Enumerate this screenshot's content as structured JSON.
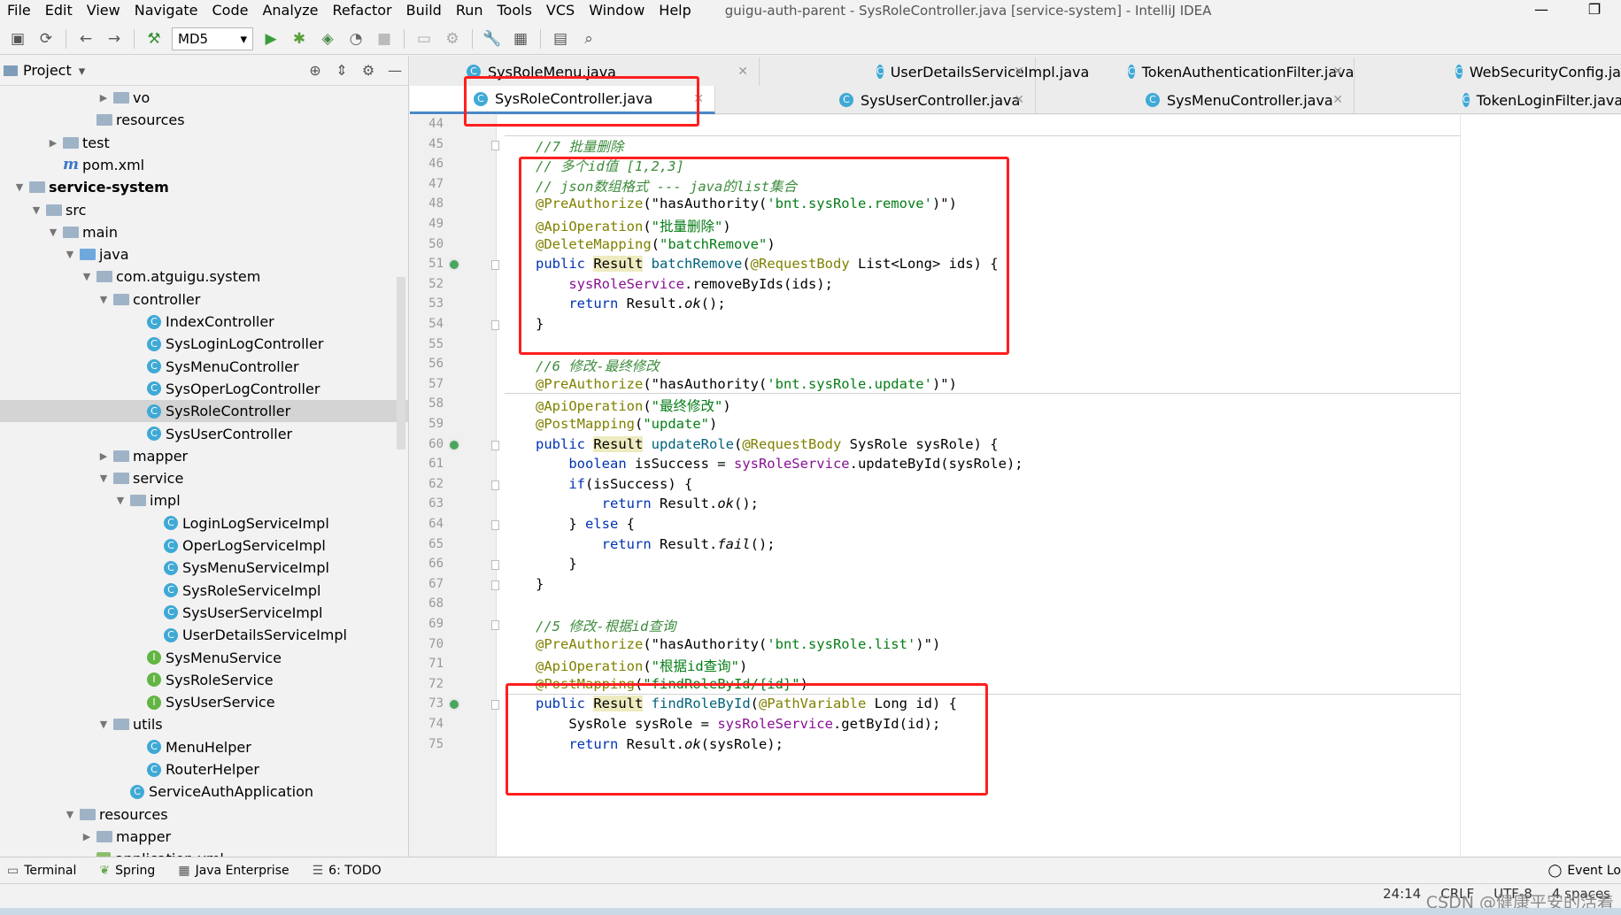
{
  "menu": [
    "File",
    "Edit",
    "View",
    "Navigate",
    "Code",
    "Analyze",
    "Refactor",
    "Build",
    "Run",
    "Tools",
    "VCS",
    "Window",
    "Help"
  ],
  "window_title": "guigu-auth-parent - SysRoleController.java [service-system] - IntelliJ IDEA",
  "toolbar": {
    "run_config": "MD5"
  },
  "project": {
    "title": "Project",
    "tree": [
      {
        "label": "vo",
        "kind": "folder",
        "arrow": "▶"
      },
      {
        "label": "resources",
        "kind": "folder",
        "arrow": ""
      },
      {
        "label": "test",
        "kind": "folder",
        "arrow": "▶"
      },
      {
        "label": "pom.xml",
        "kind": "maven",
        "arrow": ""
      },
      {
        "label": "service-system",
        "kind": "folder",
        "arrow": "▼"
      },
      {
        "label": "src",
        "kind": "folder",
        "arrow": "▼"
      },
      {
        "label": "main",
        "kind": "folder",
        "arrow": "▼"
      },
      {
        "label": "java",
        "kind": "folder-blue",
        "arrow": "▼"
      },
      {
        "label": "com.atguigu.system",
        "kind": "folder",
        "arrow": "▼"
      },
      {
        "label": "controller",
        "kind": "folder",
        "arrow": "▼"
      },
      {
        "label": "IndexController",
        "kind": "class",
        "arrow": ""
      },
      {
        "label": "SysLoginLogController",
        "kind": "class",
        "arrow": ""
      },
      {
        "label": "SysMenuController",
        "kind": "class",
        "arrow": ""
      },
      {
        "label": "SysOperLogController",
        "kind": "class",
        "arrow": ""
      },
      {
        "label": "SysRoleController",
        "kind": "class",
        "arrow": "",
        "selected": true
      },
      {
        "label": "SysUserController",
        "kind": "class",
        "arrow": ""
      },
      {
        "label": "mapper",
        "kind": "folder",
        "arrow": "▶"
      },
      {
        "label": "service",
        "kind": "folder",
        "arrow": "▼"
      },
      {
        "label": "impl",
        "kind": "folder",
        "arrow": "▼"
      },
      {
        "label": "LoginLogServiceImpl",
        "kind": "class",
        "arrow": ""
      },
      {
        "label": "OperLogServiceImpl",
        "kind": "class",
        "arrow": ""
      },
      {
        "label": "SysMenuServiceImpl",
        "kind": "class",
        "arrow": ""
      },
      {
        "label": "SysRoleServiceImpl",
        "kind": "class",
        "arrow": ""
      },
      {
        "label": "SysUserServiceImpl",
        "kind": "class",
        "arrow": ""
      },
      {
        "label": "UserDetailsServiceImpl",
        "kind": "class",
        "arrow": ""
      },
      {
        "label": "SysMenuService",
        "kind": "interface",
        "arrow": ""
      },
      {
        "label": "SysRoleService",
        "kind": "interface",
        "arrow": ""
      },
      {
        "label": "SysUserService",
        "kind": "interface",
        "arrow": ""
      },
      {
        "label": "utils",
        "kind": "folder",
        "arrow": "▼"
      },
      {
        "label": "MenuHelper",
        "kind": "class",
        "arrow": ""
      },
      {
        "label": "RouterHelper",
        "kind": "class",
        "arrow": ""
      },
      {
        "label": "ServiceAuthApplication",
        "kind": "class",
        "arrow": ""
      },
      {
        "label": "resources",
        "kind": "folder",
        "arrow": "▼"
      },
      {
        "label": "mapper",
        "kind": "folder",
        "arrow": "▶"
      },
      {
        "label": "application.yml",
        "kind": "yml",
        "arrow": ""
      }
    ]
  },
  "tabs": {
    "row1": [
      "SysRoleMenu.java",
      "UserDetailsServiceImpl.java",
      "TokenAuthenticationFilter.java",
      "WebSecurityConfig.java"
    ],
    "row2": [
      "SysRoleController.java",
      "SysUserController.java",
      "SysMenuController.java",
      "TokenLoginFilter.java"
    ],
    "active": "SysRoleController.java"
  },
  "editor": {
    "line_numbers": [
      "44",
      "45",
      "46",
      "47",
      "48",
      "49",
      "50",
      "51",
      "52",
      "53",
      "54",
      "55",
      "56",
      "57",
      "58",
      "59",
      "60",
      "61",
      "62",
      "63",
      "64",
      "65",
      "66",
      "67",
      "68",
      "69",
      "70",
      "71",
      "72",
      "73",
      "74",
      "75"
    ],
    "code": {
      "l45": "//7 批量删除",
      "l46": "// 多个id值 [1,2,3]",
      "l47": "// json数组格式 --- java的list集合",
      "l48a": "@PreAuthorize",
      "l48b": "(\"hasAuthority(",
      "l48c": "'bnt.sysRole.remove'",
      "l48d": ")\")",
      "l49a": "@ApiOperation",
      "l49b": "(",
      "l49c": "\"批量删除\"",
      "l49d": ")",
      "l50a": "@DeleteMapping",
      "l50b": "(",
      "l50c": "\"batchRemove\"",
      "l50d": ")",
      "l51a": "public ",
      "l51b": "Result",
      "l51c": " ",
      "l51d": "batchRemove",
      "l51e": "(",
      "l51f": "@RequestBody",
      "l51g": " List<Long> ids) {",
      "l52a": "    ",
      "l52b": "sysRoleService",
      "l52c": ".removeByIds(ids);",
      "l53a": "    ",
      "l53b": "return",
      "l53c": " Result.",
      "l53d": "ok",
      "l53e": "();",
      "l54": "}",
      "l56": "//6 修改-最终修改",
      "l57a": "@PreAuthorize",
      "l57b": "(\"hasAuthority(",
      "l57c": "'bnt.sysRole.update'",
      "l57d": ")\")",
      "l58a": "@ApiOperation",
      "l58b": "(",
      "l58c": "\"最终修改\"",
      "l58d": ")",
      "l59a": "@PostMapping",
      "l59b": "(",
      "l59c": "\"update\"",
      "l59d": ")",
      "l60a": "public ",
      "l60b": "Result",
      "l60c": " ",
      "l60d": "updateRole",
      "l60e": "(",
      "l60f": "@RequestBody",
      "l60g": " SysRole sysRole) {",
      "l61a": "    ",
      "l61b": "boolean",
      "l61c": " isSuccess = ",
      "l61d": "sysRoleService",
      "l61e": ".updateById(sysRole);",
      "l62a": "    ",
      "l62b": "if",
      "l62c": "(isSuccess) {",
      "l63a": "        ",
      "l63b": "return",
      "l63c": " Result.",
      "l63d": "ok",
      "l63e": "();",
      "l64a": "    } ",
      "l64b": "else",
      "l64c": " {",
      "l65a": "        ",
      "l65b": "return",
      "l65c": " Result.",
      "l65d": "fail",
      "l65e": "();",
      "l66": "    }",
      "l67": "}",
      "l69": "//5 修改-根据id查询",
      "l70a": "@PreAuthorize",
      "l70b": "(\"hasAuthority(",
      "l70c": "'bnt.sysRole.list'",
      "l70d": ")\")",
      "l71a": "@ApiOperation",
      "l71b": "(",
      "l71c": "\"根据id查询\"",
      "l71d": ")",
      "l72a": "@PostMapping",
      "l72b": "(",
      "l72c": "\"findRoleById/{id}\"",
      "l72d": ")",
      "l73a": "public ",
      "l73b": "Result",
      "l73c": " ",
      "l73d": "findRoleById",
      "l73e": "(",
      "l73f": "@PathVariable",
      "l73g": " Long id) {",
      "l74a": "    SysRole sysRole = ",
      "l74b": "sysRoleService",
      "l74c": ".getById(id);",
      "l75a": "    ",
      "l75b": "return",
      "l75c": " Result.",
      "l75d": "ok",
      "l75e": "(sysRole);"
    }
  },
  "bottom_tools": [
    "Terminal",
    "Spring",
    "Java Enterprise",
    "6: TODO"
  ],
  "event_log": "Event Lo",
  "status": {
    "position": "24:14",
    "line_sep": "CRLF",
    "encoding": "UTF-8",
    "indent": "4 spaces"
  },
  "watermark": "CSDN @健康平安的活着",
  "colors": {
    "highlight_box": "#ff1f1f",
    "selection": "#d4d4d4",
    "active_tab_underline": "#4a88c7"
  }
}
